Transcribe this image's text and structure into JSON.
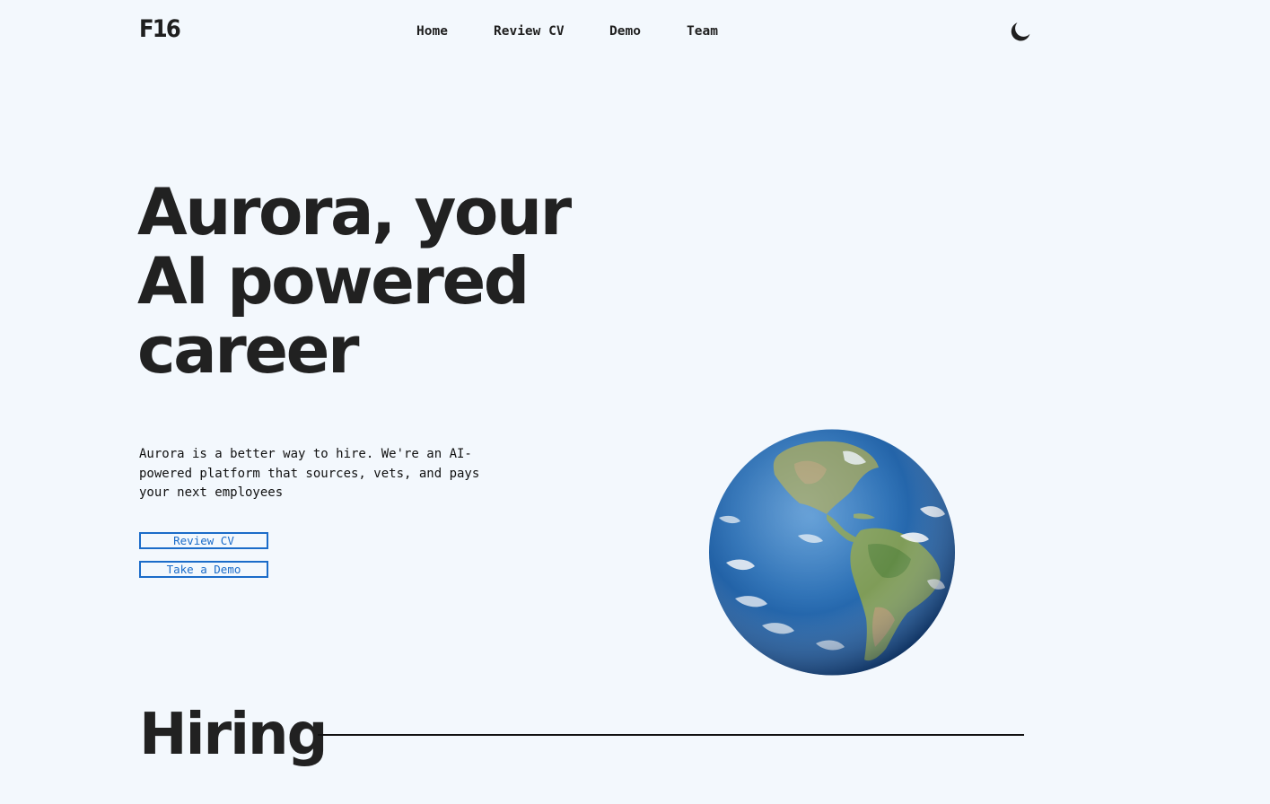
{
  "brand": {
    "logo_text": "F16"
  },
  "nav": {
    "items": [
      {
        "label": "Home"
      },
      {
        "label": "Review CV"
      },
      {
        "label": "Demo"
      },
      {
        "label": "Team"
      }
    ]
  },
  "theme_toggle": {
    "icon": "moon-icon"
  },
  "hero": {
    "title_line1": "Aurora, your",
    "title_line2": "AI powered",
    "title_line3": "career",
    "description": "Aurora is a better way to hire. We're an AI-powered platform that sources, vets, and pays your next employees",
    "buttons": {
      "review_cv": "Review CV",
      "take_demo": "Take a Demo"
    },
    "image": "earth-globe"
  },
  "sections": {
    "hiring_title": "Hiring"
  },
  "colors": {
    "background": "#f3f8fd",
    "text": "#212121",
    "accent": "#1b6cc9"
  }
}
